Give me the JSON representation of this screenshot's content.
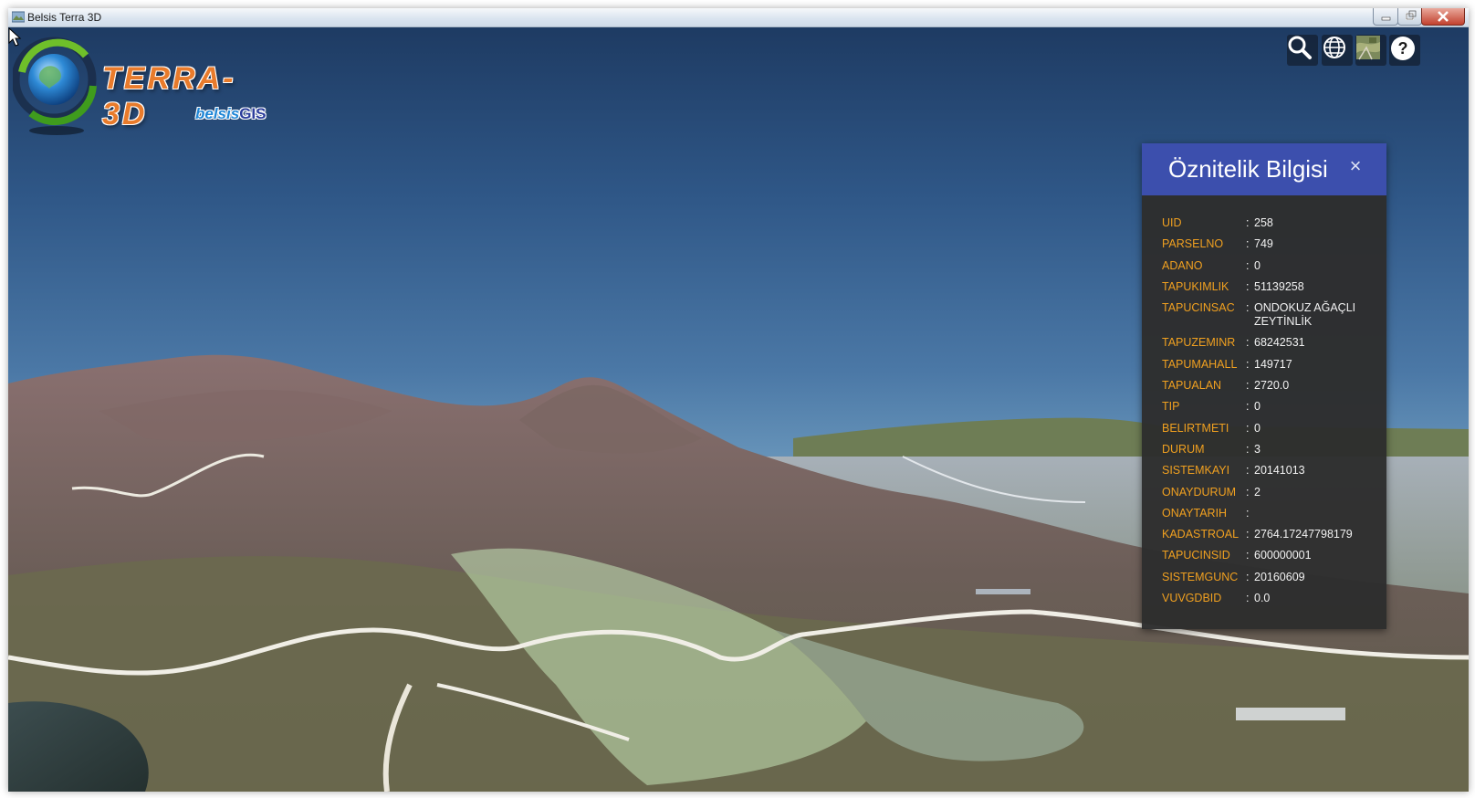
{
  "window": {
    "title": "Belsis Terra 3D"
  },
  "logo": {
    "title": "TERRA-3D",
    "sub_a": "belsis",
    "sub_b": "GIS"
  },
  "toolbar": {
    "items": [
      {
        "name": "search",
        "icon": "search-icon"
      },
      {
        "name": "globe",
        "icon": "globe-icon"
      },
      {
        "name": "basemap",
        "icon": "satellite-map-icon"
      },
      {
        "name": "help",
        "icon": "help-icon"
      }
    ]
  },
  "panel": {
    "title": "Öznitelik Bilgisi",
    "close": "×",
    "separator": ":",
    "rows": [
      {
        "key": "UID",
        "value": "258"
      },
      {
        "key": "PARSELNO",
        "value": "749"
      },
      {
        "key": "ADANO",
        "value": "0"
      },
      {
        "key": "TAPUKIMLIK",
        "value": "51139258"
      },
      {
        "key": "TAPUCINSAC",
        "value": "ONDOKUZ AĞAÇLI ZEYTİNLİK"
      },
      {
        "key": "TAPUZEMINR",
        "value": "68242531"
      },
      {
        "key": "TAPUMAHALL",
        "value": "149717"
      },
      {
        "key": "TAPUALAN",
        "value": "2720.0"
      },
      {
        "key": "TIP",
        "value": "0"
      },
      {
        "key": "BELIRTMETI",
        "value": "0"
      },
      {
        "key": "DURUM",
        "value": "3"
      },
      {
        "key": "SISTEMKAYI",
        "value": "20141013"
      },
      {
        "key": "ONAYDURUM",
        "value": "2"
      },
      {
        "key": "ONAYTARIH",
        "value": ""
      },
      {
        "key": "KADASTROAL",
        "value": "2764.17247798179"
      },
      {
        "key": "TAPUCINSID",
        "value": "600000001"
      },
      {
        "key": "SISTEMGUNC",
        "value": "20160609"
      },
      {
        "key": "VUVGDBID",
        "value": "0.0"
      }
    ]
  },
  "colors": {
    "panel_header": "#3c4fad",
    "panel_key": "#f0a020",
    "panel_bg": "#2d2d2d"
  }
}
